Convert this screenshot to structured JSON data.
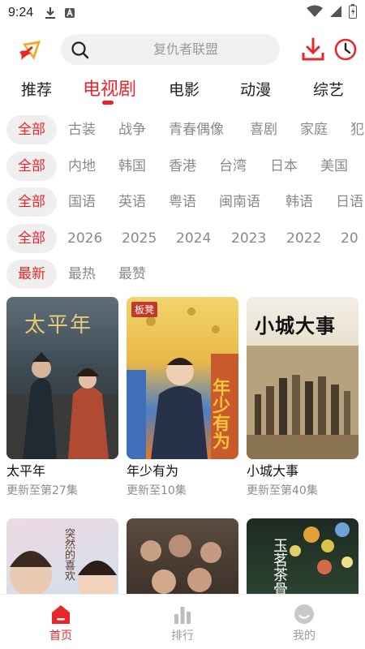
{
  "status_bar": {
    "time": "9:24"
  },
  "search": {
    "placeholder": "复仇者联盟"
  },
  "tabs": [
    {
      "label": "推荐"
    },
    {
      "label": "电视剧",
      "active": true
    },
    {
      "label": "电影"
    },
    {
      "label": "动漫"
    },
    {
      "label": "综艺"
    }
  ],
  "filters": {
    "genre": {
      "selected": "全部",
      "options": [
        "古装",
        "战争",
        "青春偶像",
        "喜剧",
        "家庭",
        "犯"
      ]
    },
    "region": {
      "selected": "全部",
      "options": [
        "内地",
        "韩国",
        "香港",
        "台湾",
        "日本",
        "美国"
      ]
    },
    "language": {
      "selected": "全部",
      "options": [
        "国语",
        "英语",
        "粤语",
        "闽南语",
        "韩语",
        "日语"
      ]
    },
    "year": {
      "selected": "全部",
      "options": [
        "2026",
        "2025",
        "2024",
        "2023",
        "2022",
        "20"
      ]
    },
    "sort": {
      "selected": "最新",
      "options": [
        "最热",
        "最赞"
      ]
    }
  },
  "shows": [
    {
      "title": "太平年",
      "poster_text": "太平年",
      "update": "更新至第27集"
    },
    {
      "title": "年少有为",
      "poster_text": "年少有为",
      "poster_badge": "板凳",
      "update": "更新至10集"
    },
    {
      "title": "小城大事",
      "poster_text": "小城大事",
      "update": "更新至第40集"
    },
    {
      "title": "",
      "poster_text": "突然的喜欢",
      "update": ""
    },
    {
      "title": "",
      "poster_text": "",
      "update": ""
    },
    {
      "title": "",
      "poster_text": "玉茗茶骨",
      "update": ""
    }
  ],
  "bottom_nav": {
    "home": "首页",
    "rank": "排行",
    "mine": "我的"
  },
  "colors": {
    "accent": "#e8262b",
    "chip_bg": "#efefef",
    "muted_text": "#8a8a8a"
  }
}
